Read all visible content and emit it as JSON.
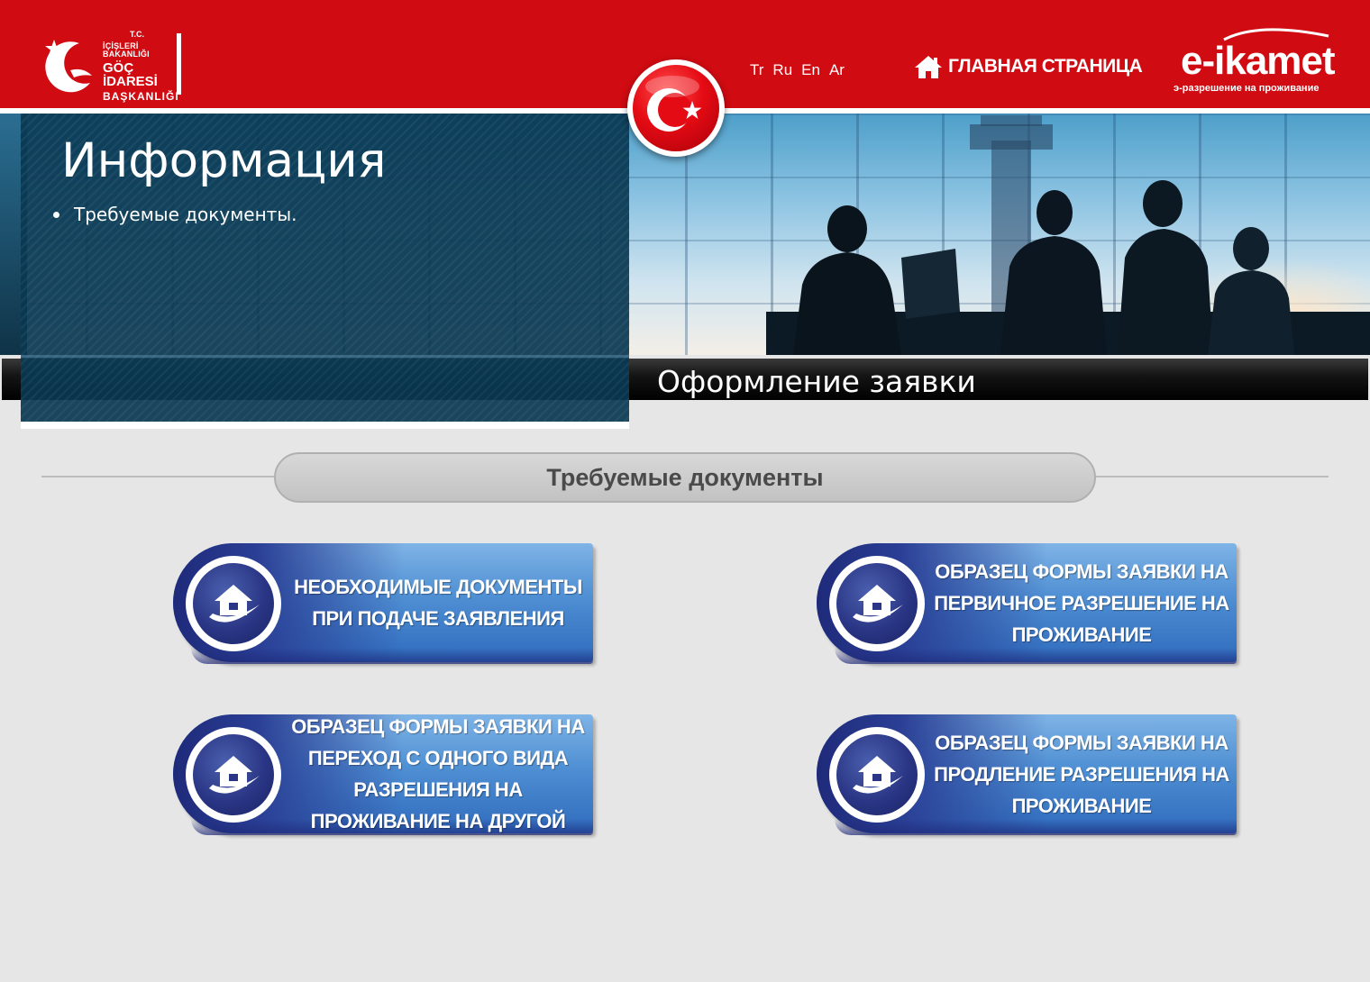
{
  "header": {
    "logo": {
      "tc": "T.C.",
      "line1": "İÇİŞLERİ BAKANLIĞI",
      "line2": "GÖÇ İDARESİ",
      "line3": "BAŞKANLIĞI"
    },
    "languages": [
      "Tr",
      "Ru",
      "En",
      "Ar"
    ],
    "home_label": "ГЛАВНАЯ СТРАНИЦА",
    "brand": {
      "name": "e-ikamet",
      "subtitle": "э-разрешение на проживание"
    }
  },
  "info_panel": {
    "title": "Информация",
    "items": [
      "Требуемые документы."
    ]
  },
  "banner": {
    "action_title": "Оформление заявки"
  },
  "section": {
    "heading": "Требуемые документы"
  },
  "documents": [
    {
      "label": "НЕОБХОДИМЫЕ ДОКУМЕНТЫ\nПРИ ПОДАЧЕ ЗАЯВЛЕНИЯ"
    },
    {
      "label": "ОБРАЗЕЦ ФОРМЫ ЗАЯВКИ НА\nПЕРВИЧНОЕ РАЗРЕШЕНИЕ НА\nПРОЖИВАНИЕ"
    },
    {
      "label": "ОБРАЗЕЦ ФОРМЫ ЗАЯВКИ НА\nПЕРЕХОД С ОДНОГО ВИДА\nРАЗРЕШЕНИЯ НА\nПРОЖИВАНИЕ НА ДРУГОЙ"
    },
    {
      "label": "ОБРАЗЕЦ ФОРМЫ ЗАЯВКИ НА\nПРОДЛЕНИЕ РАЗРЕШЕНИЯ НА\nПРОЖИВАНИЕ"
    }
  ],
  "colors": {
    "header_red": "#d00b12",
    "panel_blue": "#093852",
    "button_blue": "#4f8fd3",
    "page_bg": "#e6e6e6"
  },
  "icons": {
    "home": "house-icon",
    "document_button": "house-check-icon",
    "flag": "turkish-flag-icon",
    "emblem": "crescent-star-icon"
  }
}
